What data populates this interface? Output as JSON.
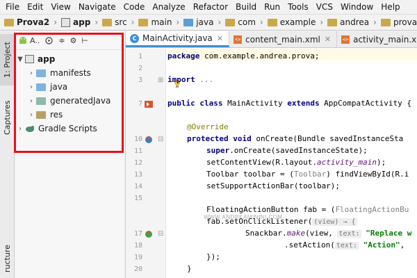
{
  "menu": [
    "File",
    "Edit",
    "View",
    "Navigate",
    "Code",
    "Analyze",
    "Refactor",
    "Build",
    "Run",
    "Tools",
    "VCS",
    "Window",
    "Help"
  ],
  "breadcrumb": [
    "Prova2",
    "app",
    "src",
    "main",
    "java",
    "com",
    "example",
    "andrea",
    "prova",
    "Ma"
  ],
  "left_strip": {
    "project_tab": "1: Project",
    "captures_tab": "Captures",
    "structure_tab": "ructure"
  },
  "project_panel": {
    "toolbar": {
      "view_label": "A..",
      "collapse_label": "≑",
      "settings_label": "⚙",
      "hide_label": "⊢"
    },
    "root": "app",
    "items": [
      "manifests",
      "java",
      "generatedJava",
      "res"
    ],
    "gradle": "Gradle Scripts"
  },
  "editor": {
    "tabs": [
      {
        "label": "MainActivity.java",
        "type": "class"
      },
      {
        "label": "content_main.xml",
        "type": "xml"
      },
      {
        "label": "activity_main.xml",
        "type": "xml"
      }
    ],
    "line_numbers": [
      "1",
      "2",
      "3",
      "",
      "7",
      "",
      "",
      "10",
      "11",
      "12",
      "13",
      "14",
      "15",
      "",
      "17",
      "18",
      "19",
      "20",
      "21"
    ],
    "code": {
      "l1_kw": "package",
      "l1_rest": " com.example.andrea.prova;",
      "l3_kw": "import",
      "l3_rest": " ...",
      "l4_kw": "public class",
      "l4_name": " MainActivity ",
      "l4_kw2": "extends",
      "l4_rest": " AppCompatActivity {",
      "l6": "@Override",
      "l7_kw": "protected void",
      "l7_rest": " onCreate(Bundle savedInstanceSta",
      "l8_kw": "super",
      "l8_rest": ".onCreate(savedInstanceState);",
      "l9_pre": "setContentView(R.layout.",
      "l9_it": "activity_main",
      "l9_post": ");",
      "l10_pre": "Toolbar toolbar = (",
      "l10_gr": "Toolbar",
      "l10_post": ") findViewById(R.i",
      "l11": "setSupportActionBar(toolbar);",
      "l12_pre": "FloatingActionButton fab = (",
      "l12_gr": "FloatingActionBu",
      "l13_pre": "fab.setOnClickListener(",
      "l13_hint": "(view) → {",
      "l14_pre": "Snackbar.",
      "l14_it": "make",
      "l14_mid": "(view, ",
      "l14_hint": "text:",
      "l14_str": " \"Replace w",
      "l15_pre": ".setAction(",
      "l15_hint": "text:",
      "l15_str": " \"Action\"",
      "l15_post": ",",
      "l16": "});",
      "l17": "}"
    },
    "watermark": "WWW.ANDREAMININI.COM"
  },
  "colors": {
    "highlight": "#e8101b",
    "accent": "#3d8fd8",
    "keyword": "#000080",
    "annotation": "#808000",
    "string": "#008000"
  }
}
